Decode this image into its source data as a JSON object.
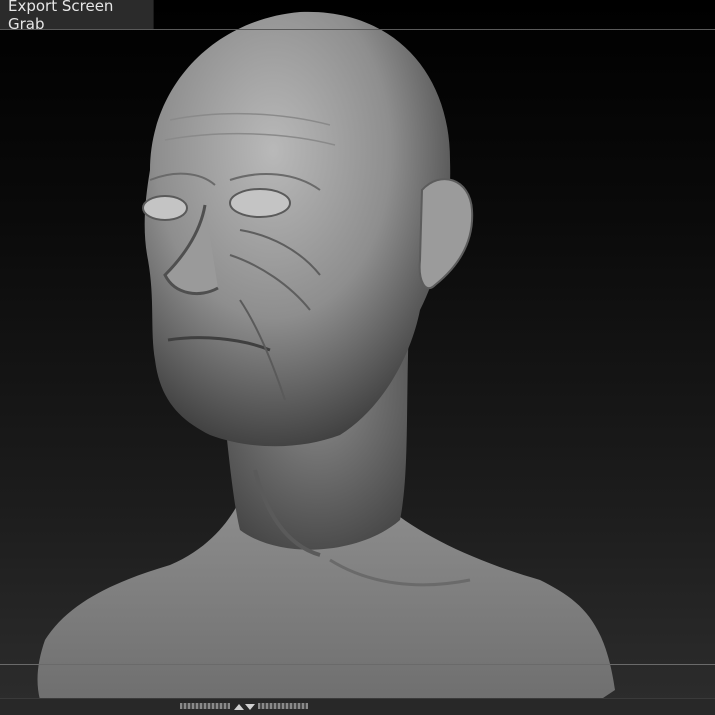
{
  "toolbar": {
    "export_label": "Export Screen Grab"
  },
  "canvas": {
    "object": "sculpted bust model"
  },
  "bottom_bar": {
    "toggle_icon": "expand-collapse-arrows"
  }
}
